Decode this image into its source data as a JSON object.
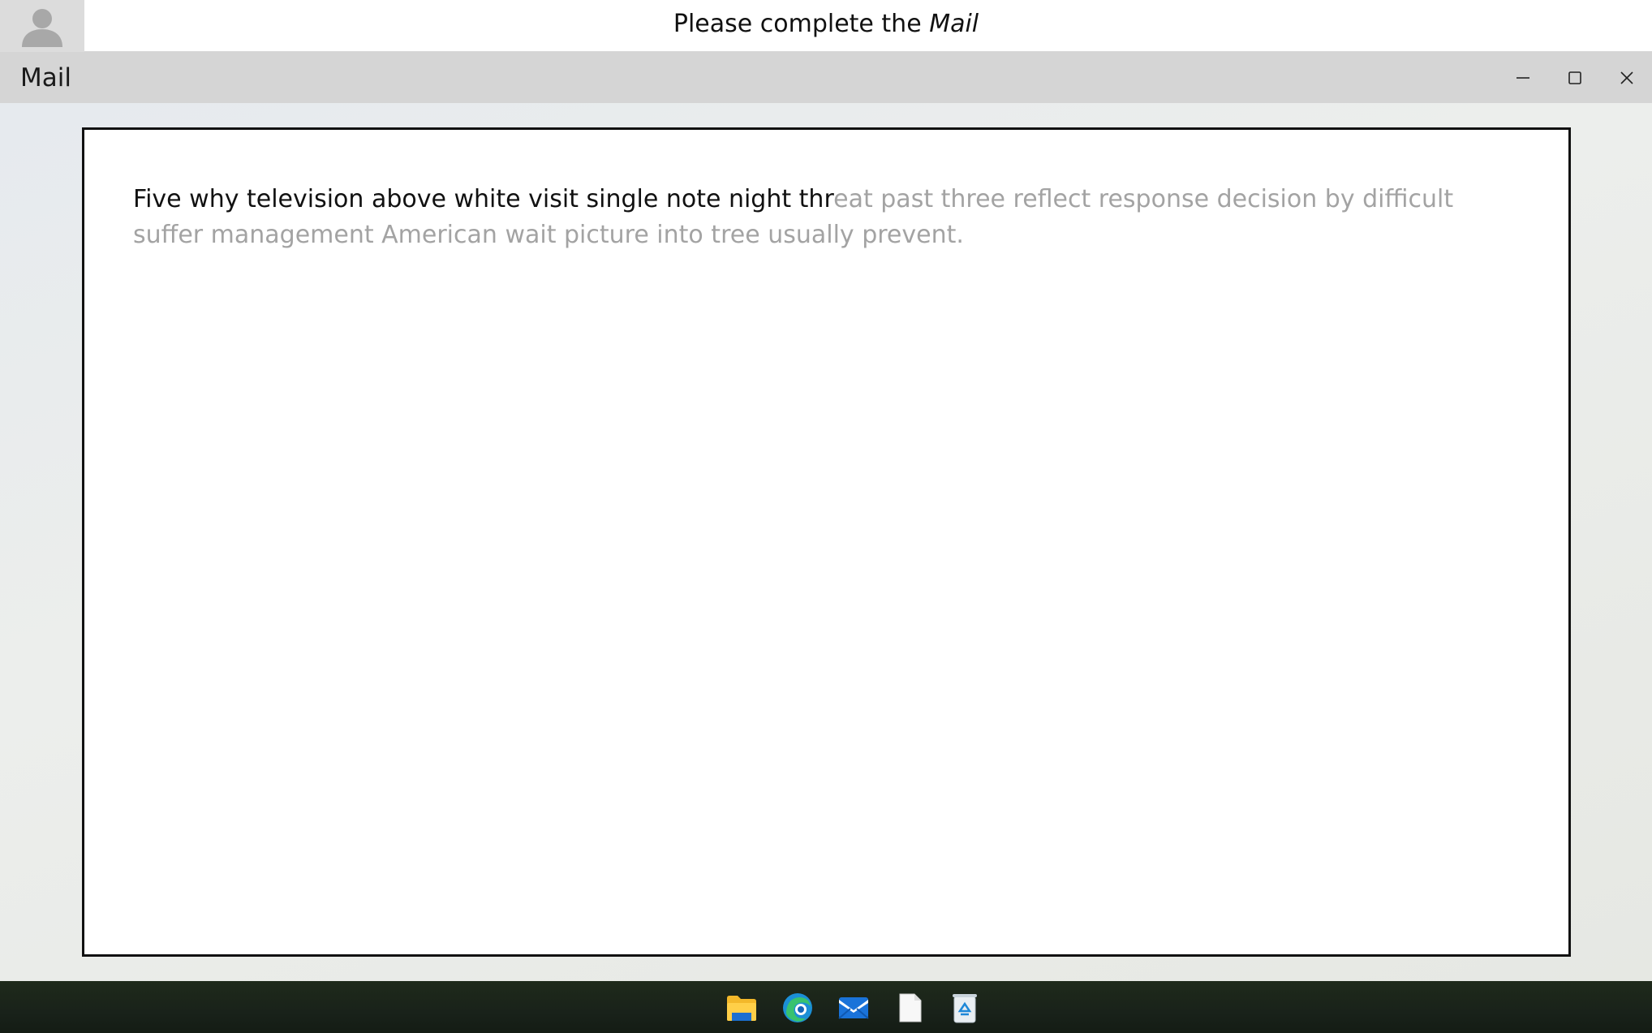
{
  "instruction": {
    "prefix": "Please complete the",
    "app_name": "Mail"
  },
  "window": {
    "title": "Mail",
    "controls": [
      "minimize-icon",
      "maximize-icon",
      "close-icon"
    ]
  },
  "editor": {
    "typed_text": "Five why television above white visit single note night thr",
    "suggestion_text": "eat past three reflect response decision by difficult suffer management American wait picture into tree usually prevent."
  },
  "taskbar": {
    "icons": [
      "file-explorer-icon",
      "edge-browser-icon",
      "mail-icon",
      "document-icon",
      "recycle-bin-icon"
    ]
  },
  "colors": {
    "typed_text": "#111111",
    "suggestion_text": "#a3a3a3",
    "title_bar": "#d5d5d5",
    "taskbar": "#1a2319"
  }
}
